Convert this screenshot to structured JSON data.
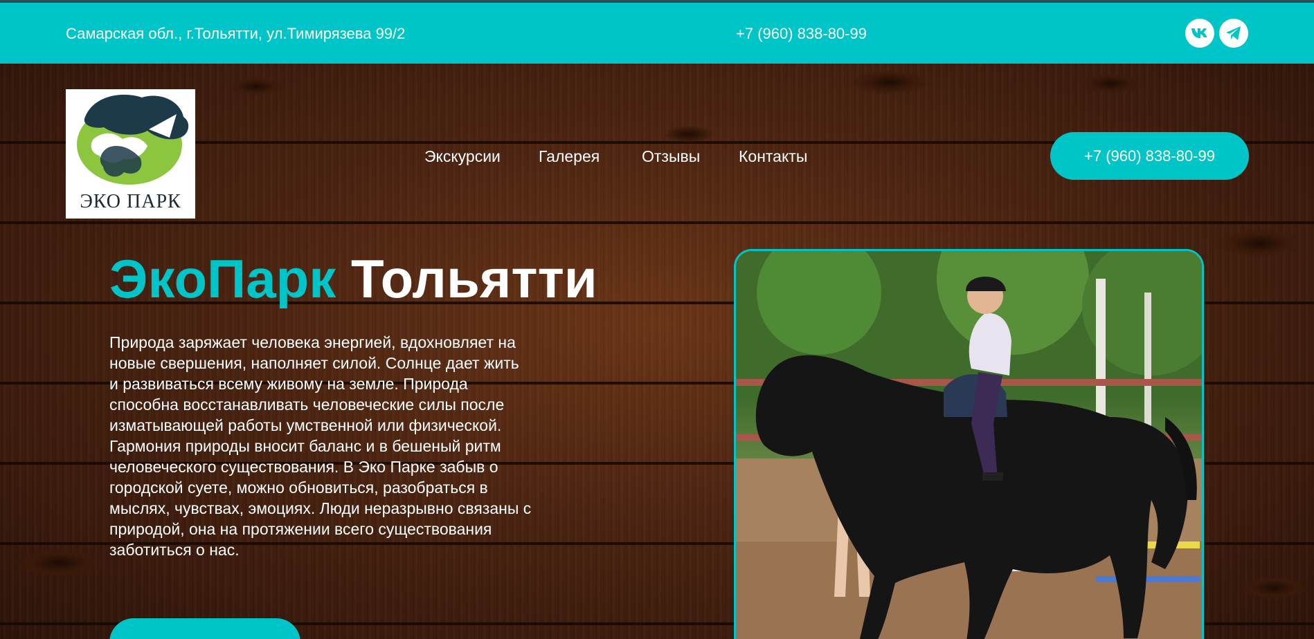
{
  "topbar": {
    "address": "Самарская обл., г.Тольятти, ул.Тимирязева 99/2",
    "phone": "+7 (960) 838-80-99",
    "social": [
      {
        "name": "vk-icon"
      },
      {
        "name": "telegram-icon"
      }
    ]
  },
  "logo": {
    "text": "ЭКО ПАРК"
  },
  "nav": {
    "items": [
      "Экскурсии",
      "Галерея",
      "Отзывы",
      "Контакты"
    ]
  },
  "header_cta": {
    "label": "+7 (960) 838-80-99"
  },
  "hero": {
    "title_accent": "ЭкоПарк",
    "title_main": "Тольятти",
    "description": "Природа заряжает человека энергией, вдохновляет на новые свершения, наполняет силой. Солнце дает жить и развиваться всему живому на земле. Природа способна восстанавливать человеческие силы после изматывающей работы умственной или физической. Гармония природы вносит баланс и в бешеный ритм человеческого существования. В Эко Парке забыв о городской суете, можно обновиться, разобраться в мыслях, чувствах, эмоциях. Люди неразрывно связаны с природой, она на протяжении всего существования заботиться о нас."
  },
  "colors": {
    "accent": "#00c5c8",
    "wood": "#4a220f",
    "text": "#ffffff"
  }
}
